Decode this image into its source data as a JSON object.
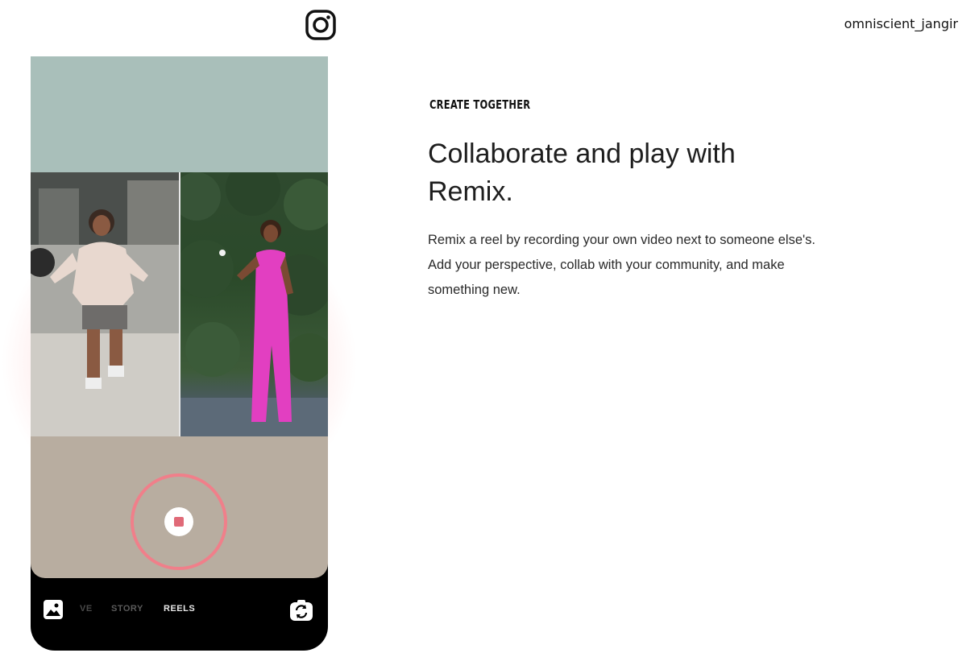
{
  "header": {
    "logo_icon": "instagram-icon",
    "username": "omniscient_jangir"
  },
  "phone": {
    "modes": [
      "VE",
      "STORY",
      "REELS"
    ],
    "active_mode": "REELS",
    "gallery_icon": "gallery-icon",
    "flip_camera_icon": "flip-camera-icon",
    "record_icon": "record-stop-icon",
    "accent_color": "#f07f8a"
  },
  "feature": {
    "eyebrow": "CREATE TOGETHER",
    "title": "Collaborate and play with Remix.",
    "description": "Remix a reel by recording your own video next to someone else's. Add your perspective, collab with your community, and make something new."
  }
}
